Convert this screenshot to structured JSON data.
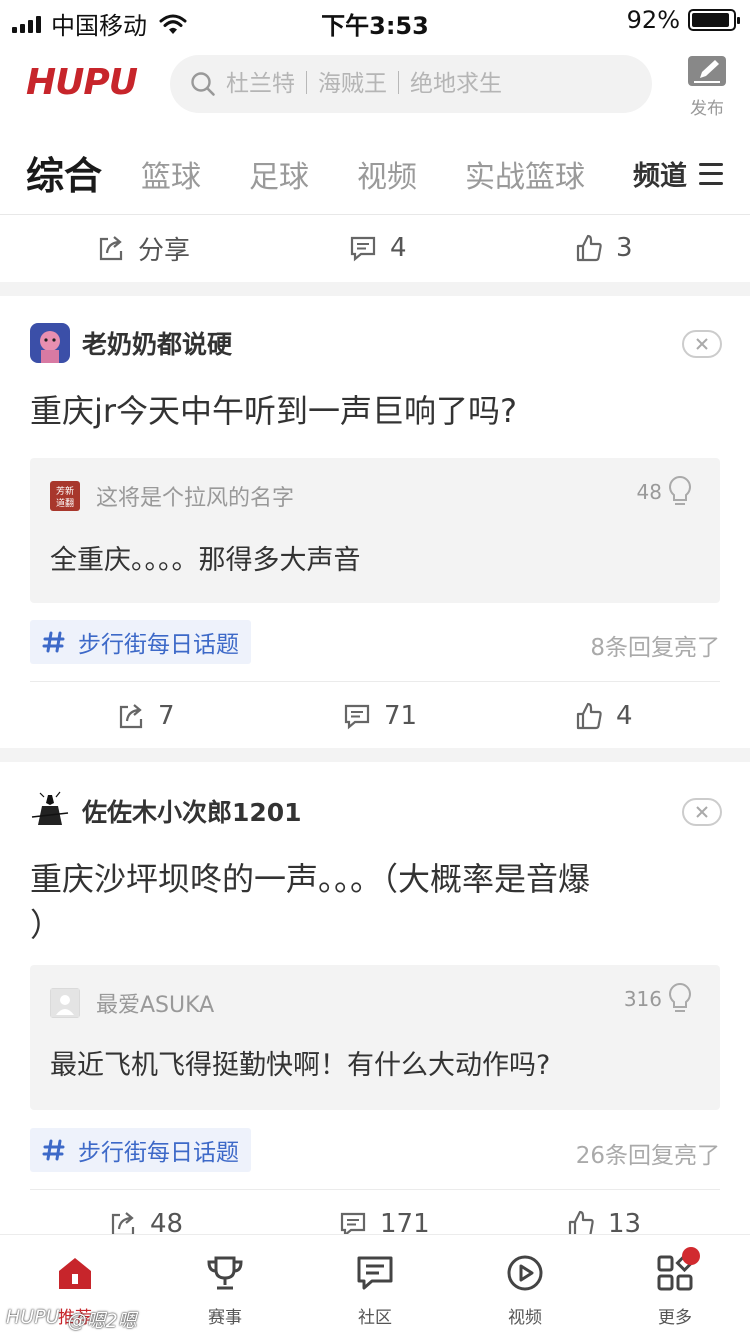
{
  "status": {
    "carrier": "中国移动",
    "time": "下午3:53",
    "battery": "92%",
    "battery_level": 0.92
  },
  "header": {
    "logo": "HUPU",
    "search_placeholder": "杜兰特｜海贼王｜绝地求生",
    "publish_label": "发布"
  },
  "tabs": [
    {
      "label": "综合",
      "active": true
    },
    {
      "label": "篮球",
      "active": false
    },
    {
      "label": "足球",
      "active": false
    },
    {
      "label": "视频",
      "active": false
    },
    {
      "label": "实战篮球",
      "active": false
    }
  ],
  "channel_label": "频道",
  "top_actions": {
    "share": "分享",
    "comments": "4",
    "likes": "3"
  },
  "posts": [
    {
      "author": "老奶奶都说硬",
      "title": "重庆jr今天中午听到一声巨响了吗?",
      "reply": {
        "author": "这将是个拉风的名字",
        "likes": "48",
        "text": "全重庆。。。。那得多大声音",
        "avatar_text": "芳新道翻"
      },
      "topic": "步行街每日话题",
      "lit_text": "8条回复亮了",
      "stats": {
        "shares": "7",
        "comments": "71",
        "likes": "4"
      }
    },
    {
      "author": "佐佐木小次郎1201",
      "title_line1": "重庆沙坪坝咚的一声。。。（大概率是音爆",
      "title_line2": "）",
      "reply": {
        "author": "最爱ASUKA",
        "likes": "316",
        "text": "最近飞机飞得挺勤快啊！有什么大动作吗?"
      },
      "topic": "步行街每日话题",
      "lit_text": "26条回复亮了",
      "stats": {
        "shares": "48",
        "comments": "171",
        "likes": "13"
      }
    }
  ],
  "bottom_nav": [
    {
      "label": "推荐",
      "icon": "home-icon",
      "active": true
    },
    {
      "label": "赛事",
      "icon": "trophy-icon",
      "active": false
    },
    {
      "label": "社区",
      "icon": "chat-icon",
      "active": false
    },
    {
      "label": "视频",
      "icon": "play-icon",
      "active": false
    },
    {
      "label": "更多",
      "icon": "grid-icon",
      "active": false,
      "badge": true
    }
  ],
  "watermark": {
    "brand": "HUPU",
    "handle": "@嗯2嗯"
  },
  "colors": {
    "brand_red": "#c7252b",
    "topic_blue": "#3d69c8"
  }
}
